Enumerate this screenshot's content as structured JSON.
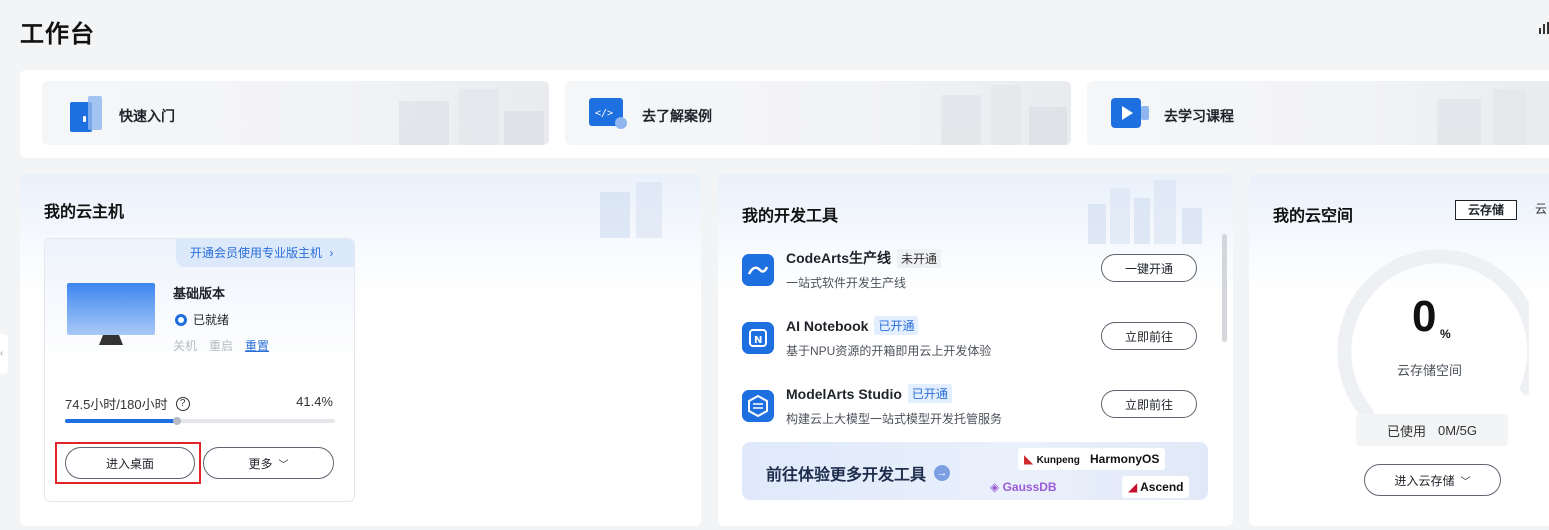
{
  "page": {
    "title": "工作台"
  },
  "quick_entries": [
    {
      "label": "快速入门",
      "icon": "door-icon"
    },
    {
      "label": "去了解案例",
      "icon": "code-window-icon"
    },
    {
      "label": "去学习课程",
      "icon": "video-play-icon"
    }
  ],
  "vm": {
    "title": "我的云主机",
    "promo": "开通会员使用专业版主机",
    "edition": "基础版本",
    "status": "已就绪",
    "actions": {
      "shutdown": "关机",
      "restart": "重启",
      "reset": "重置"
    },
    "usage_text": "74.5小时/180小时",
    "usage_help": "?",
    "usage_percent_text": "41.4%",
    "usage_fraction": 0.414,
    "enter_desktop": "进入桌面",
    "more": "更多"
  },
  "dev_tools": {
    "title": "我的开发工具",
    "items": [
      {
        "name": "CodeArts生产线",
        "tag": "未开通",
        "tag_state": "off",
        "desc": "一站式软件开发生产线",
        "action": "一键开通"
      },
      {
        "name": "AI Notebook",
        "tag": "已开通",
        "tag_state": "on",
        "desc": "基于NPU资源的开箱即用云上开发体验",
        "action": "立即前往"
      },
      {
        "name": "ModelArts Studio",
        "tag": "已开通",
        "tag_state": "on",
        "desc": "构建云上大模型一站式模型开发托管服务",
        "action": "立即前往"
      }
    ],
    "banner": "前往体验更多开发工具",
    "banner_arrow": "→",
    "brands": [
      "Kunpeng",
      "HarmonyOS",
      "GaussDB",
      "Ascend"
    ]
  },
  "cloud_space": {
    "title": "我的云空间",
    "tabs": [
      "云存储",
      "云"
    ],
    "value": "0",
    "unit": "%",
    "label": "云存储空间",
    "used_label": "已使用",
    "used_value": "0M/5G",
    "enter": "进入云存储"
  },
  "colors": {
    "accent": "#1e6fe0",
    "link": "#2a6ed8",
    "highlight": "#e0262b"
  }
}
